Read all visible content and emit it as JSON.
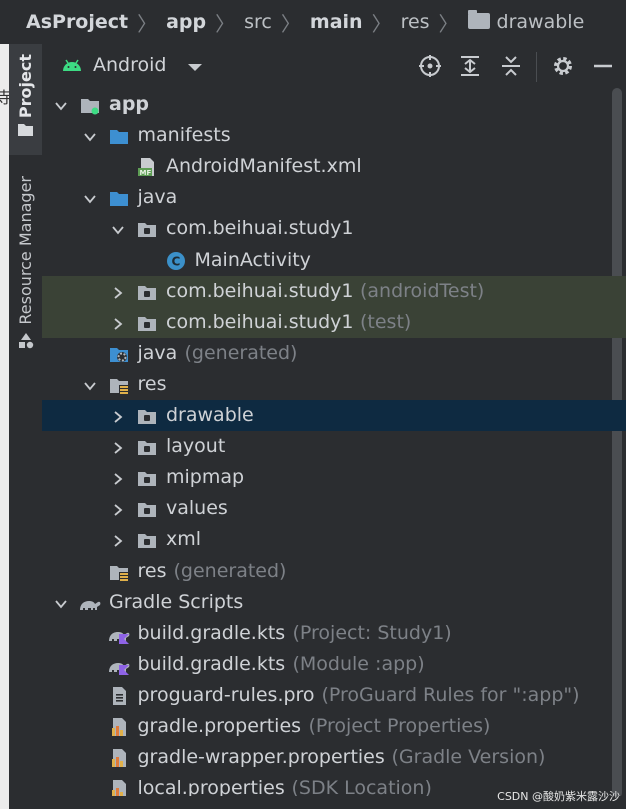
{
  "breadcrumb": [
    "AsProject",
    "app",
    "src",
    "main",
    "res",
    "drawable"
  ],
  "left_fragment": "寺",
  "sidebar": {
    "project_label": "Project",
    "resource_manager_label": "Resource Manager"
  },
  "panel": {
    "view_mode": "Android"
  },
  "tree": [
    {
      "id": "app",
      "label": "app",
      "extra": "",
      "depth": 0,
      "expanded": true,
      "icon": "module-folder-icon",
      "bold": true
    },
    {
      "id": "manifests",
      "label": "manifests",
      "extra": "",
      "depth": 1,
      "expanded": true,
      "icon": "folder-icon"
    },
    {
      "id": "androidmanifest",
      "label": "AndroidManifest.xml",
      "extra": "",
      "depth": 2,
      "expanded": null,
      "icon": "manifest-file-icon"
    },
    {
      "id": "java",
      "label": "java",
      "extra": "",
      "depth": 1,
      "expanded": true,
      "icon": "folder-icon"
    },
    {
      "id": "pkg-main",
      "label": "com.beihuai.study1",
      "extra": "",
      "depth": 2,
      "expanded": true,
      "icon": "package-icon"
    },
    {
      "id": "mainactivity",
      "label": "MainActivity",
      "extra": "",
      "depth": 3,
      "expanded": null,
      "icon": "class-icon"
    },
    {
      "id": "pkg-androidtest",
      "label": "com.beihuai.study1",
      "extra": "(androidTest)",
      "depth": 2,
      "expanded": false,
      "icon": "package-icon",
      "highlight": "test"
    },
    {
      "id": "pkg-test",
      "label": "com.beihuai.study1",
      "extra": "(test)",
      "depth": 2,
      "expanded": false,
      "icon": "package-icon",
      "highlight": "test"
    },
    {
      "id": "java-generated",
      "label": "java",
      "extra": "(generated)",
      "depth": 1,
      "expanded": null,
      "icon": "generated-folder-icon"
    },
    {
      "id": "res",
      "label": "res",
      "extra": "",
      "depth": 1,
      "expanded": true,
      "icon": "res-folder-icon"
    },
    {
      "id": "drawable",
      "label": "drawable",
      "extra": "",
      "depth": 2,
      "expanded": false,
      "icon": "package-icon",
      "selected": true
    },
    {
      "id": "layout",
      "label": "layout",
      "extra": "",
      "depth": 2,
      "expanded": false,
      "icon": "package-icon"
    },
    {
      "id": "mipmap",
      "label": "mipmap",
      "extra": "",
      "depth": 2,
      "expanded": false,
      "icon": "package-icon"
    },
    {
      "id": "values",
      "label": "values",
      "extra": "",
      "depth": 2,
      "expanded": false,
      "icon": "package-icon"
    },
    {
      "id": "xml",
      "label": "xml",
      "extra": "",
      "depth": 2,
      "expanded": false,
      "icon": "package-icon"
    },
    {
      "id": "res-generated",
      "label": "res",
      "extra": "(generated)",
      "depth": 1,
      "expanded": null,
      "icon": "res-folder-icon"
    },
    {
      "id": "gradle-scripts",
      "label": "Gradle Scripts",
      "extra": "",
      "depth": 0,
      "expanded": true,
      "icon": "gradle-icon"
    },
    {
      "id": "build-project",
      "label": "build.gradle.kts",
      "extra": "(Project: Study1)",
      "depth": 1,
      "expanded": null,
      "icon": "gradle-kts-icon"
    },
    {
      "id": "build-module",
      "label": "build.gradle.kts",
      "extra": "(Module :app)",
      "depth": 1,
      "expanded": null,
      "icon": "gradle-kts-icon"
    },
    {
      "id": "proguard",
      "label": "proguard-rules.pro",
      "extra": "(ProGuard Rules for \":app\")",
      "depth": 1,
      "expanded": null,
      "icon": "text-file-icon"
    },
    {
      "id": "gradle-props",
      "label": "gradle.properties",
      "extra": "(Project Properties)",
      "depth": 1,
      "expanded": null,
      "icon": "properties-file-icon"
    },
    {
      "id": "wrapper-props",
      "label": "gradle-wrapper.properties",
      "extra": "(Gradle Version)",
      "depth": 1,
      "expanded": null,
      "icon": "properties-file-icon"
    },
    {
      "id": "local-props",
      "label": "local.properties",
      "extra": "(SDK Location)",
      "depth": 1,
      "expanded": null,
      "icon": "properties-file-icon"
    }
  ],
  "watermark": "CSDN @酸奶紫米露沙沙",
  "colors": {
    "background": "#2b2d30",
    "selection": "#0e2a41",
    "test_highlight": "#3a4236",
    "folder_blue": "#3d8fd1",
    "muted_text": "#7d8187",
    "android_green": "#3ddc84"
  }
}
